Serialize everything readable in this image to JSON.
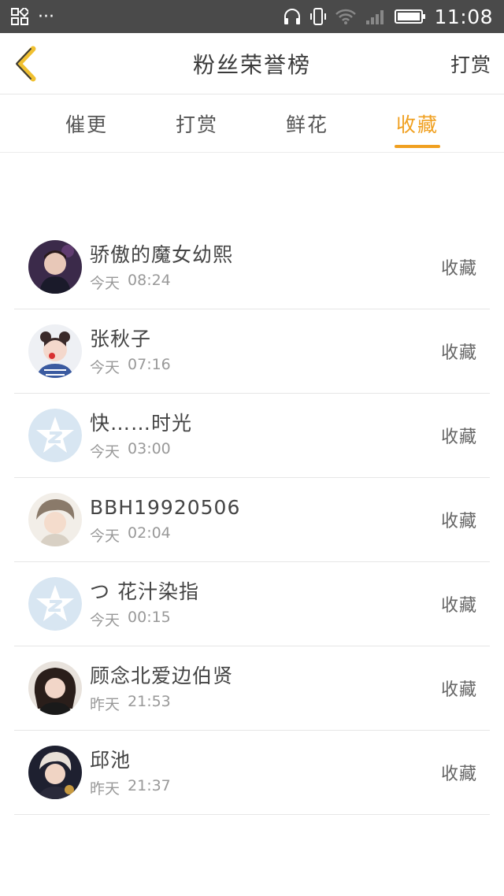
{
  "status_bar": {
    "time": "11:08",
    "left_dots": "···"
  },
  "header": {
    "title": "粉丝荣誉榜",
    "action_label": "打赏",
    "accent": "#f0a020"
  },
  "tabs": [
    {
      "label": "催更",
      "active": false
    },
    {
      "label": "打赏",
      "active": false
    },
    {
      "label": "鲜花",
      "active": false
    },
    {
      "label": "收藏",
      "active": true
    }
  ],
  "list": {
    "items": [
      {
        "name": "骄傲的魔女幼熙",
        "day": "今天",
        "time": "08:24",
        "action": "收藏",
        "avatar": "photo"
      },
      {
        "name": "张秋子",
        "day": "今天",
        "time": "07:16",
        "action": "收藏",
        "avatar": "photo"
      },
      {
        "name": "快……时光",
        "day": "今天",
        "time": "03:00",
        "action": "收藏",
        "avatar": "default-qq-icon"
      },
      {
        "name": "BBH19920506",
        "day": "今天",
        "time": "02:04",
        "action": "收藏",
        "avatar": "photo"
      },
      {
        "name": "つ 花汁染指",
        "day": "今天",
        "time": "00:15",
        "action": "收藏",
        "avatar": "default-qq-icon"
      },
      {
        "name": "顾念北爱边伯贤",
        "day": "昨天",
        "time": "21:53",
        "action": "收藏",
        "avatar": "photo"
      },
      {
        "name": "邱池",
        "day": "昨天",
        "time": "21:37",
        "action": "收藏",
        "avatar": "photo"
      }
    ]
  }
}
